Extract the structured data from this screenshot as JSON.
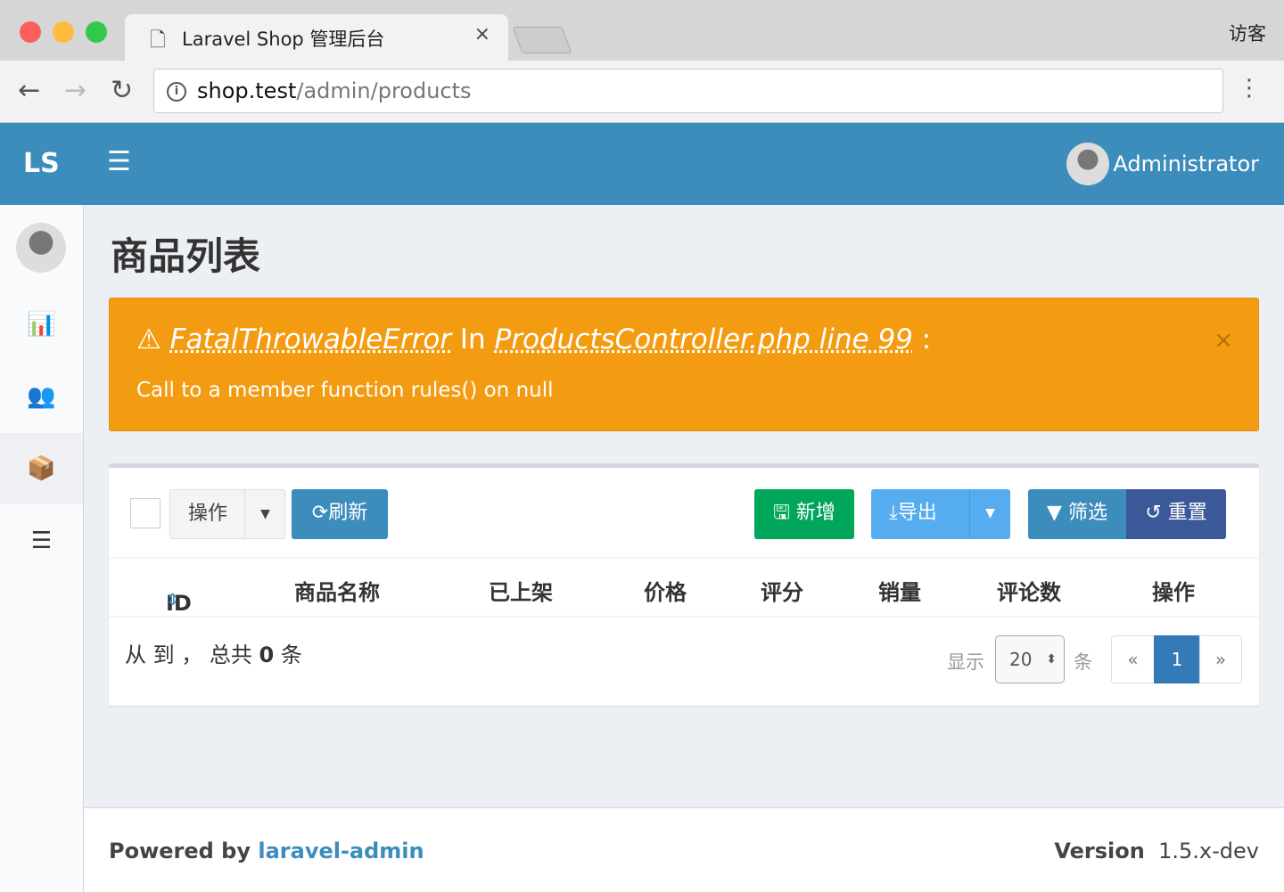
{
  "browser": {
    "tab_title": "Laravel Shop 管理后台",
    "guest": "访客",
    "url_host": "shop.test",
    "url_path": "/admin/products"
  },
  "header": {
    "logo": "LS",
    "user": "Administrator"
  },
  "page": {
    "title": "商品列表"
  },
  "alert": {
    "error": "FatalThrowableError",
    "in": " In ",
    "location": "ProductsController.php line 99",
    "colon": " :",
    "message": "Call to a member function rules() on null"
  },
  "toolbar": {
    "actions": "操作",
    "refresh": "刷新",
    "create": "新增",
    "export": "导出",
    "filter": "筛选",
    "reset": "重置"
  },
  "table": {
    "columns": [
      "ID",
      "商品名称",
      "已上架",
      "价格",
      "评分",
      "销量",
      "评论数",
      "操作"
    ]
  },
  "pagination": {
    "summary_prefix": "从 到 ， 总共 ",
    "total": "0",
    "summary_suffix": " 条",
    "show": "显示",
    "per_page": "20",
    "unit": "条",
    "prev": "«",
    "current": "1",
    "next": "»"
  },
  "footer": {
    "powered": "Powered by ",
    "link": "laravel-admin",
    "version_label": "Version",
    "version": "1.5.x-dev"
  },
  "colors": {
    "header": "#3c8dbc",
    "warning": "#f39c12",
    "success": "#00a65a",
    "info": "#55acee",
    "primary_dark": "#3b5998"
  }
}
